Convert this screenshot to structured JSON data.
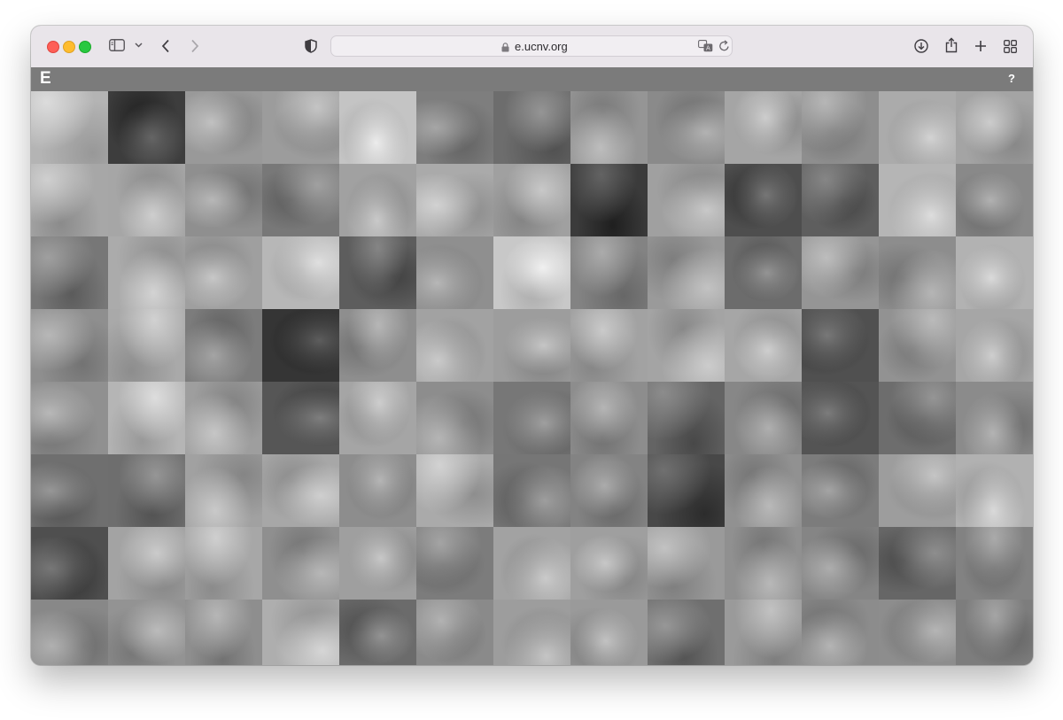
{
  "browser": {
    "url": "e.ucnv.org"
  },
  "app": {
    "logo": "E",
    "help_label": "?"
  },
  "tile_tones": [
    [
      "#b4b4b4",
      "#3d3d3d",
      "#999999",
      "#9c9c9c",
      "#c4c4c4",
      "#7e7e7e",
      "#6d6d6d",
      "#959595",
      "#8a8a8a",
      "#a5a5a5",
      "#8e8e8e",
      "#ababab",
      "#a4a4a4"
    ],
    [
      "#a7a7a7",
      "#a6a6a6",
      "#8f8f8f",
      "#787878",
      "#a1a1a1",
      "#aaaaaa",
      "#a0a0a0",
      "#3b3b3b",
      "#a0a0a0",
      "#4e4e4e",
      "#5e5e5e",
      "#b5b5b5",
      "#898989"
    ],
    [
      "#777777",
      "#ababab",
      "#9f9f9f",
      "#b7b7b7",
      "#5d5d5d",
      "#8f8f8f",
      "#c8c8c8",
      "#838383",
      "#9a9a9a",
      "#6c6c6c",
      "#959595",
      "#8d8d8d",
      "#b2b2b2"
    ],
    [
      "#8f8f8f",
      "#a9a9a9",
      "#7c7c7c",
      "#353535",
      "#8e8e8e",
      "#a2a2a2",
      "#9d9d9d",
      "#a2a2a2",
      "#a4a4a4",
      "#a6a6a6",
      "#505050",
      "#929292",
      "#a6a6a6"
    ],
    [
      "#909090",
      "#b5b5b5",
      "#9e9e9e",
      "#565656",
      "#a5a5a5",
      "#8d8d8d",
      "#777777",
      "#8d8d8d",
      "#646464",
      "#878787",
      "#545454",
      "#6d6d6d",
      "#8b8b8b"
    ],
    [
      "#6f6f6f",
      "#6e6e6e",
      "#a1a1a1",
      "#a7a7a7",
      "#8d8d8d",
      "#aaaaaa",
      "#767676",
      "#838383",
      "#484848",
      "#919191",
      "#7c7c7c",
      "#9d9d9d",
      "#b1b1b1"
    ],
    [
      "#4f4f4f",
      "#a3a3a3",
      "#a7a7a7",
      "#8f8f8f",
      "#9f9f9f",
      "#7c7c7c",
      "#a2a2a2",
      "#9f9f9f",
      "#9a9a9a",
      "#909090",
      "#858585",
      "#666666",
      "#828282"
    ],
    [
      "#888888",
      "#939393",
      "#8e8e8e",
      "#aeaeae",
      "#6b6b6b",
      "#8a8a8a",
      "#9d9d9d",
      "#9a9a9a",
      "#6f6f6f",
      "#9a9a9a",
      "#8c8c8c",
      "#8d8d8d",
      "#7d7d7d"
    ]
  ]
}
